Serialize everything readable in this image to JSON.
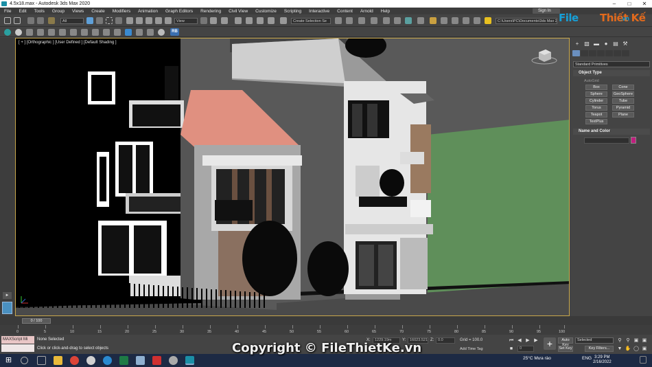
{
  "window": {
    "title": "4.5x18.max - Autodesk 3ds Max 2020",
    "buttons": [
      "–",
      "□",
      "✕"
    ]
  },
  "menu": [
    "File",
    "Edit",
    "Tools",
    "Group",
    "Views",
    "Create",
    "Modifiers",
    "Animation",
    "Graph Editors",
    "Rendering",
    "Civil View",
    "Customize",
    "Scripting",
    "Interactive",
    "Content",
    "Arnold",
    "Help"
  ],
  "signin": "Sign In",
  "toolbar": {
    "filter_combo": "All",
    "view_combo": "View",
    "selection_set": "Create Selection Se",
    "project_path": "C:\\Users\\PC\\Documents\\3ds Max 2",
    "rb_badge": "RB"
  },
  "logo": {
    "part1": "File",
    "part2": "Thiết Kế",
    "part3": ".vn"
  },
  "viewport": {
    "label": "[ + ] [Orthographic ] [User Defined ] [Default Shading ]"
  },
  "command_panel": {
    "tabs": [
      "+",
      "▧",
      "▬",
      "●",
      "▤",
      "⚒"
    ],
    "category": "Standard Primitives",
    "object_type_header": "Object Type",
    "autogrid": "AutoGrid",
    "primitives": [
      "Box",
      "Cone",
      "Sphere",
      "GeoSphere",
      "Cylinder",
      "Tube",
      "Torus",
      "Pyramid",
      "Teapot",
      "Plane",
      "TextPlus"
    ],
    "name_color_header": "Name and Color"
  },
  "timeline": {
    "slider": "0 / 100",
    "ticks": [
      "0",
      "5",
      "10",
      "15",
      "20",
      "25",
      "30",
      "35",
      "40",
      "45",
      "50",
      "55",
      "60",
      "65",
      "70",
      "75",
      "80",
      "85",
      "90",
      "95",
      "100"
    ]
  },
  "status": {
    "maxscript": "MAXScript Mi",
    "selection": "None Selected",
    "prompt": "Click or click-and-drag to select objects",
    "x_label": "X:",
    "x_value": "1229.19m",
    "y_label": "Y:",
    "y_value": "16023.521",
    "z_label": "Z:",
    "z_value": "0.0",
    "grid": "Grid = 100.0",
    "add_time_tag": "Add Time Tag",
    "auto_key": "Auto Key",
    "set_key": "Set Key",
    "selected": "Selected",
    "key_filters": "Key Filters...",
    "frame": "0"
  },
  "copyright": "Copyright © FileThietKe.vn",
  "taskbar": {
    "weather": "25°C  Mưa rào",
    "lang": "ENG",
    "time": "3:29 PM",
    "date": "2/16/2022"
  },
  "colors": {
    "viewport_border": "#c9a84c",
    "roof": "#e09080",
    "lawn": "#5f8f5a",
    "swatch": "#c01e7e"
  }
}
